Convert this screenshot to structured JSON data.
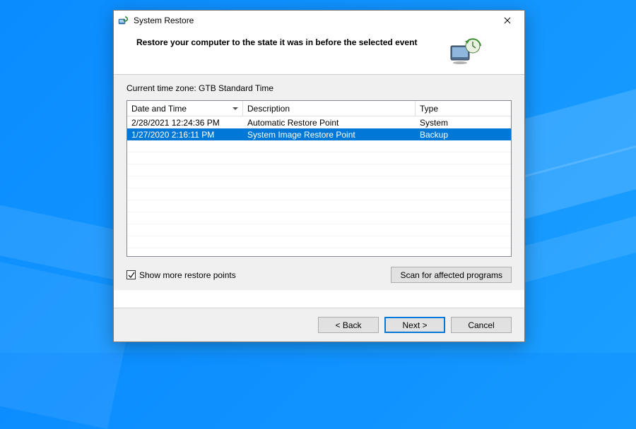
{
  "window": {
    "title": "System Restore",
    "heading": "Restore your computer to the state it was in before the selected event"
  },
  "timezone_label": "Current time zone: GTB Standard Time",
  "columns": {
    "date": "Date and Time",
    "description": "Description",
    "type": "Type"
  },
  "rows": [
    {
      "date": "2/28/2021 12:24:36 PM",
      "description": "Automatic Restore Point",
      "type": "System",
      "selected": false
    },
    {
      "date": "1/27/2020 2:16:11 PM",
      "description": "System Image Restore Point",
      "type": "Backup",
      "selected": true
    }
  ],
  "show_more": {
    "checked": true,
    "label": "Show more restore points"
  },
  "buttons": {
    "scan": "Scan for affected programs",
    "back": "< Back",
    "next": "Next >",
    "cancel": "Cancel"
  }
}
